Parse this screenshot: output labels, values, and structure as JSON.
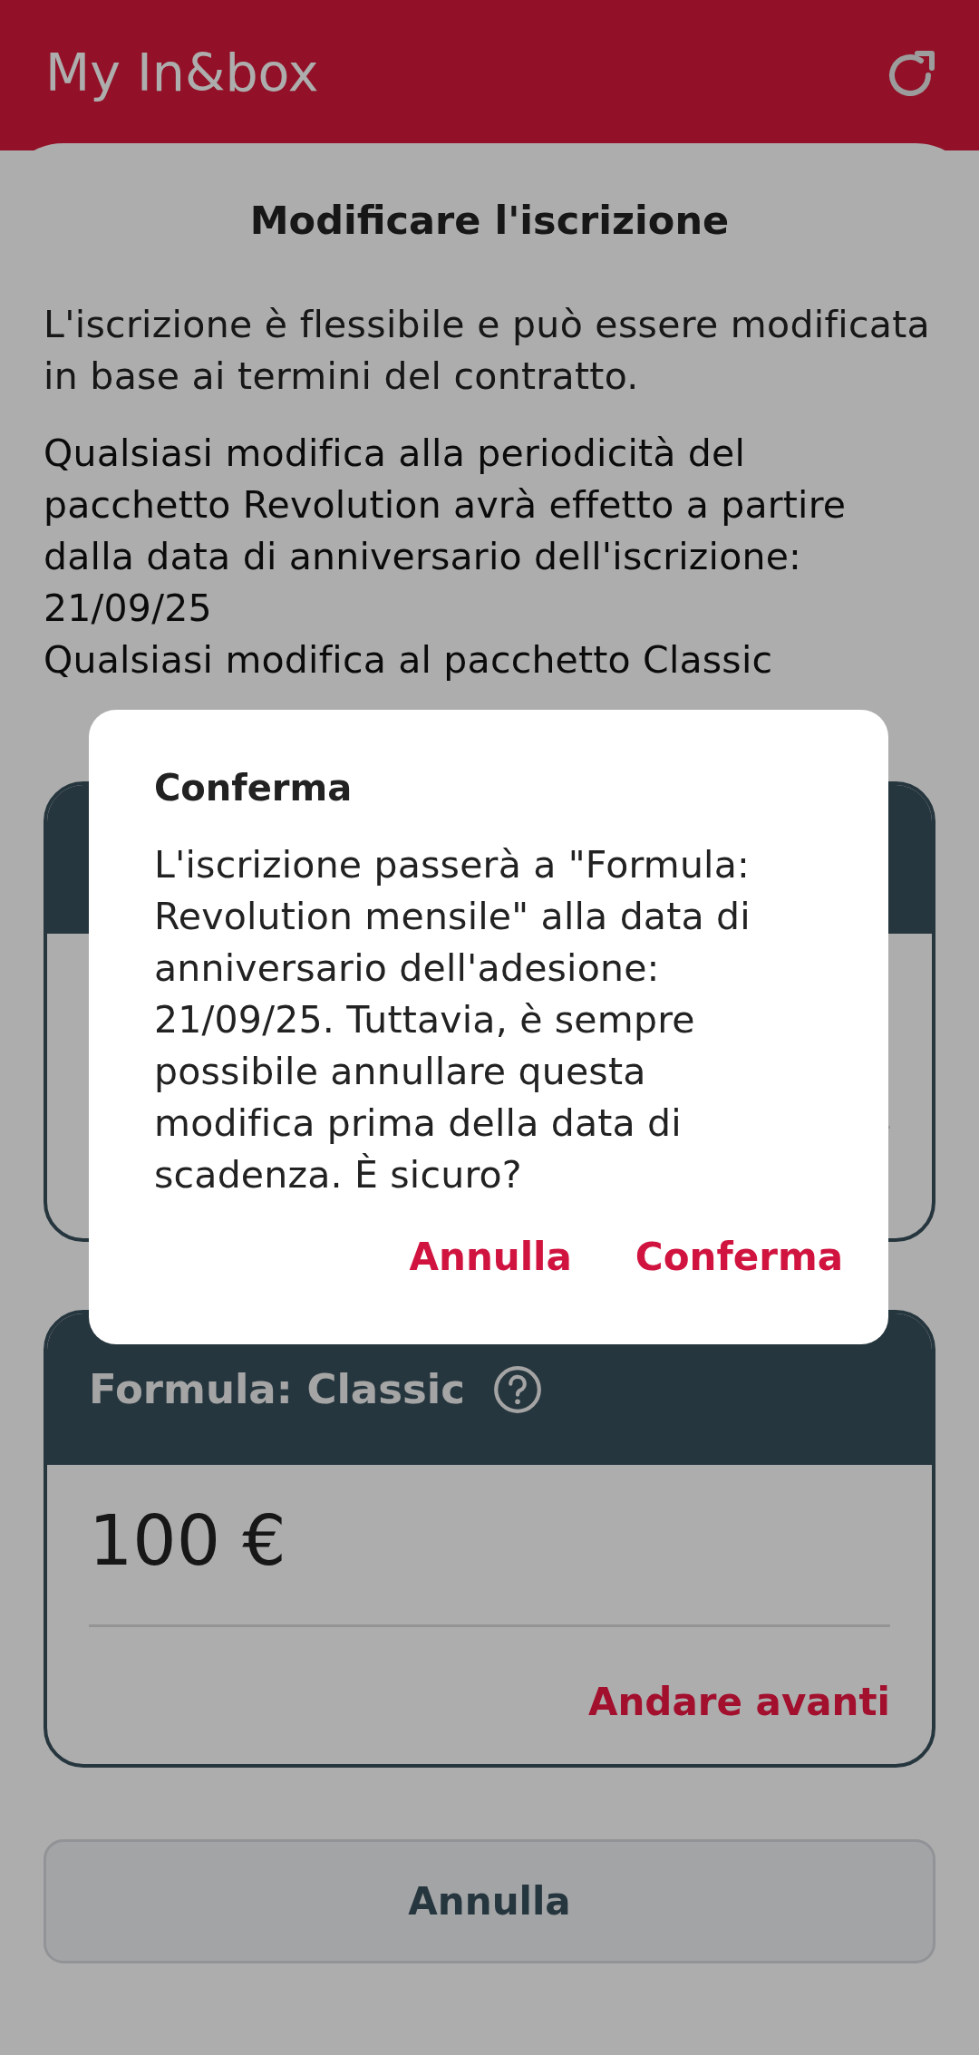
{
  "app_bar": {
    "title": "My In&box"
  },
  "sheet": {
    "title": "Modificare l'iscrizione",
    "intro": "L'iscrizione è flessibile e può essere modificata in base ai termini del contratto.",
    "notice_lines": [
      "Qualsiasi modifica alla periodicità del pacchetto Revolution avrà effetto a partire dalla data di anniversario dell'iscrizione:",
      "21/09/25",
      "Qualsiasi modifica al pacchetto Classic"
    ]
  },
  "plan": {
    "title": "Formula: Classic",
    "price": "100 €",
    "action": "Andare avanti"
  },
  "cancel_button": "Annulla",
  "dialog": {
    "title": "Conferma",
    "message": "L'iscrizione passerà a \"Formula: Revolution mensile\" alla data di anniversario dell'adesione: 21/09/25. Tuttavia, è sempre possibile annullare questa modifica prima della data di scadenza. È sicuro?",
    "buttons": [
      "Annulla",
      "Conferma"
    ]
  }
}
